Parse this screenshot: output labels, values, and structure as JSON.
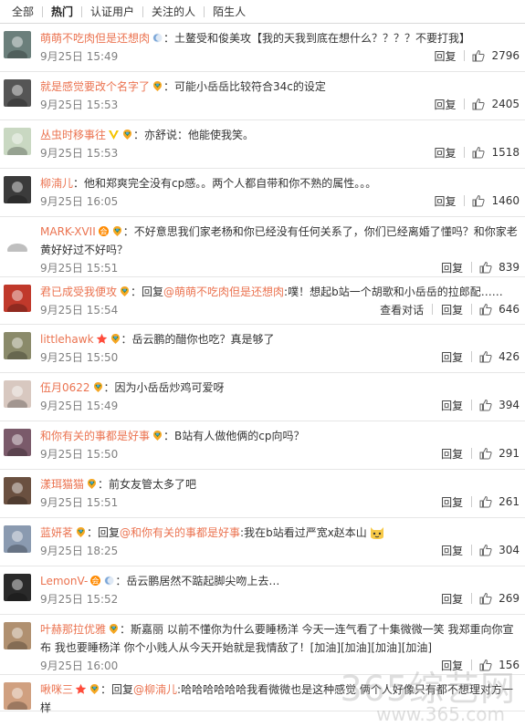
{
  "tabs": [
    "全部",
    "热门",
    "认证用户",
    "关注的人",
    "陌生人"
  ],
  "comments": [
    {
      "user": "萌萌不吃肉但是还想肉",
      "badges": [
        "crescent"
      ],
      "text": "：土鳌受和俊美攻【我的天我到底在想什么？？？？不要打我】",
      "time": "9月25日 15:49",
      "reply": "回复",
      "likes": "2796",
      "avatar_color": "#6b7f7b"
    },
    {
      "user": "就是感觉要改个名字了",
      "badges": [
        "vip"
      ],
      "text": "：可能小岳岳比较符合34c的设定",
      "time": "9月25日 15:53",
      "reply": "回复",
      "likes": "2405",
      "avatar_color": "#555"
    },
    {
      "user": "丛虫时移事往",
      "badges": [
        "v",
        "vip"
      ],
      "text": "：亦舒说：他能使我笑。",
      "time": "9月25日 15:53",
      "reply": "回复",
      "likes": "1518",
      "avatar_color": "#c9d8c2"
    },
    {
      "user": "柳湳儿",
      "badges": [],
      "text": "：他和郑爽完全没有cp感。。两个人都自带和你不熟的属性。。。",
      "time": "9月25日 16:05",
      "reply": "回复",
      "likes": "1460",
      "avatar_color": "#3b3b3b"
    },
    {
      "user": "MARK-XVII",
      "badges": [
        "red",
        "vip"
      ],
      "text": "：不好意思我们家老杨和你已经没有任何关系了，你们已经离婚了懂吗？和你家老黄好好过不好吗？",
      "time": "9月25日 15:51",
      "reply": "回复",
      "likes": "839",
      "avatar_color": "#fff"
    },
    {
      "user": "君已成受我便攻",
      "badges": [
        "vip"
      ],
      "text_pre": "：回复",
      "reply_to": "@萌萌不吃肉但是还想肉",
      "text": ":噗！想起b站一个胡歌和小岳岳的拉郎配……",
      "time": "9月25日 15:54",
      "view": "查看对话",
      "reply": "回复",
      "likes": "646",
      "avatar_color": "#c0392b"
    },
    {
      "user": "littlehawk",
      "badges": [
        "star",
        "vip"
      ],
      "text": "：岳云鹏的醋你也吃？真是够了",
      "time": "9月25日 15:50",
      "reply": "回复",
      "likes": "426",
      "avatar_color": "#8a8a6a"
    },
    {
      "user": "伍月0622",
      "badges": [
        "vip"
      ],
      "text": "：因为小岳岳炒鸡可爱呀",
      "time": "9月25日 15:49",
      "reply": "回复",
      "likes": "394",
      "avatar_color": "#d8c8c0"
    },
    {
      "user": "和你有关的事都是好事",
      "badges": [
        "vip"
      ],
      "text": "：B站有人做他俩的cp向吗？",
      "time": "9月25日 15:50",
      "reply": "回复",
      "likes": "291",
      "avatar_color": "#7a5a6a"
    },
    {
      "user": "漾珥猫猫",
      "badges": [
        "vip"
      ],
      "text": "：前女友管太多了吧",
      "time": "9月25日 15:51",
      "reply": "回复",
      "likes": "261",
      "avatar_color": "#6a5040"
    },
    {
      "user": "蓝妍茗",
      "badges": [
        "vip"
      ],
      "text_pre": "：回复",
      "reply_to": "@和你有关的事都是好事",
      "text": ":我在b站看过严宽x赵本山",
      "emoji": "cat",
      "time": "9月25日 18:25",
      "reply": "回复",
      "likes": "304",
      "avatar_color": "#8a9ab0"
    },
    {
      "user": "LemonV-",
      "badges": [
        "red",
        "crescent"
      ],
      "text": "：岳云鹏居然不踮起脚尖吻上去…",
      "time": "9月25日 15:52",
      "reply": "回复",
      "likes": "269",
      "avatar_color": "#2a2a2a"
    },
    {
      "user": "叶赫那拉优雅",
      "badges": [
        "vip"
      ],
      "text": "：斯嘉丽 以前不懂你为什么要睡杨洋 今天一连气看了十集微微一笑 我郑重向你宣布 我也要睡杨洋 你个小贱人从今天开始就是我情敌了！[加油][加油][加油][加油]",
      "time": "9月25日 16:00",
      "reply": "回复",
      "likes": "156",
      "avatar_color": "#b09070"
    },
    {
      "user": "啾咪三",
      "badges": [
        "star",
        "vip"
      ],
      "text_pre": "：回复",
      "reply_to": "@柳湳儿",
      "text": ":哈哈哈哈哈哈我看微微也是这种感觉 俩个人好像只有都不想理对方一样",
      "time": "",
      "reply": "",
      "likes": "",
      "avatar_color": "#d0a080"
    }
  ],
  "watermark": "365综艺网",
  "watermark_sub": "www.365.com"
}
